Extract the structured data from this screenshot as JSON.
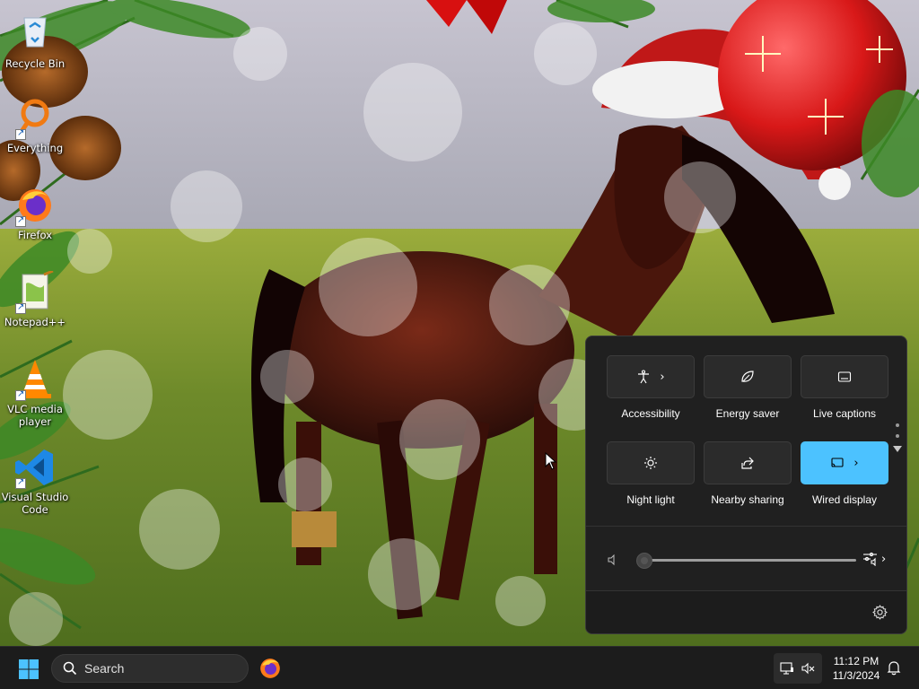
{
  "desktop": {
    "icons": [
      {
        "label": "Recycle Bin",
        "icon": "recycle-bin-icon"
      },
      {
        "label": "Everything",
        "icon": "everything-search-icon"
      },
      {
        "label": "Firefox",
        "icon": "firefox-icon"
      },
      {
        "label": "Notepad++",
        "icon": "notepad-plus-plus-icon"
      },
      {
        "label": "VLC media player",
        "icon": "vlc-cone-icon"
      },
      {
        "label": "Visual Studio Code",
        "icon": "vscode-icon"
      }
    ]
  },
  "quick_settings": {
    "tiles": [
      {
        "label": "Accessibility",
        "icon": "accessibility-icon",
        "has_chevron": true,
        "active": false
      },
      {
        "label": "Energy saver",
        "icon": "energy-saver-leaf-icon",
        "has_chevron": false,
        "active": false
      },
      {
        "label": "Live captions",
        "icon": "captions-icon",
        "has_chevron": false,
        "active": false
      },
      {
        "label": "Night light",
        "icon": "brightness-icon",
        "has_chevron": false,
        "active": false
      },
      {
        "label": "Nearby sharing",
        "icon": "share-icon",
        "has_chevron": false,
        "active": false
      },
      {
        "label": "Wired display",
        "icon": "cast-icon",
        "has_chevron": true,
        "active": true
      }
    ],
    "chevron": "›",
    "volume": {
      "level": 0,
      "icon": "speaker-muted-icon",
      "output_icon": "audio-output-icon"
    },
    "settings_icon": "gear-icon",
    "accent_color": "#4cc2ff"
  },
  "taskbar": {
    "search_placeholder": "Search",
    "time": "11:12 PM",
    "date": "11/3/2024",
    "pinned": [
      {
        "name": "Firefox",
        "icon": "firefox-icon"
      }
    ],
    "tray_icons": [
      "network-icon",
      "volume-muted-icon"
    ],
    "notification_icon": "bell-icon"
  }
}
